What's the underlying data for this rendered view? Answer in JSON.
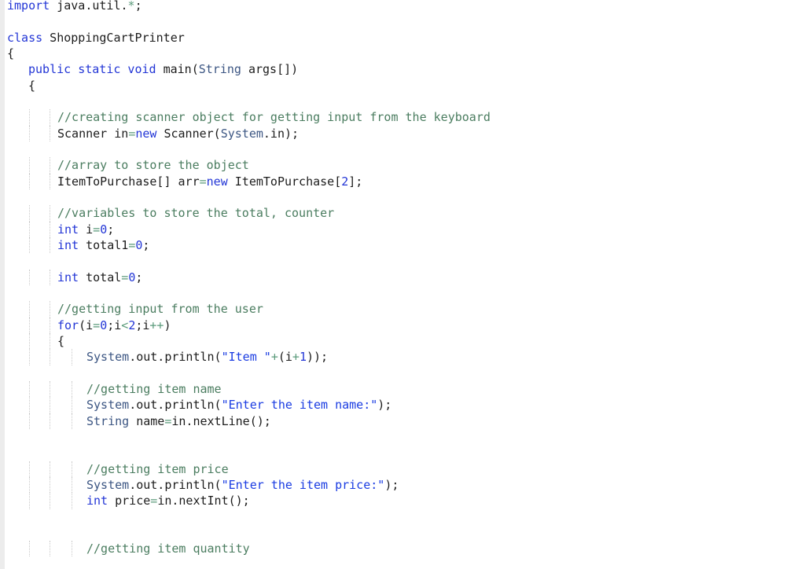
{
  "editor": {
    "language": "java",
    "colors": {
      "keyword": "#2336d6",
      "comment": "#4b7d60",
      "type": "#3c5683",
      "string": "#1a3ce2",
      "text": "#1c1c1c"
    },
    "lines": [
      {
        "level": 0,
        "tokens": [
          {
            "t": "import",
            "c": "kw"
          },
          {
            "t": " java.util.",
            "c": "tx"
          },
          {
            "t": "*",
            "c": "op"
          },
          {
            "t": ";",
            "c": "tx"
          }
        ]
      },
      {
        "level": 0,
        "tokens": []
      },
      {
        "level": 0,
        "tokens": [
          {
            "t": "class",
            "c": "kw"
          },
          {
            "t": " ShoppingCartPrinter",
            "c": "tx"
          }
        ]
      },
      {
        "level": 0,
        "tokens": [
          {
            "t": "{",
            "c": "tx"
          }
        ]
      },
      {
        "level": 1,
        "tokens": [
          {
            "t": "public static void",
            "c": "kw"
          },
          {
            "t": " main(",
            "c": "tx"
          },
          {
            "t": "String",
            "c": "ty"
          },
          {
            "t": " args[])",
            "c": "tx"
          }
        ]
      },
      {
        "level": 1,
        "tokens": [
          {
            "t": "{",
            "c": "tx"
          }
        ]
      },
      {
        "level": 0,
        "tokens": []
      },
      {
        "level": 2,
        "tokens": [
          {
            "t": "//creating scanner object for getting input from the keyboard",
            "c": "cm"
          }
        ]
      },
      {
        "level": 2,
        "tokens": [
          {
            "t": "Scanner in",
            "c": "tx"
          },
          {
            "t": "=",
            "c": "op"
          },
          {
            "t": "new",
            "c": "kw"
          },
          {
            "t": " Scanner(",
            "c": "tx"
          },
          {
            "t": "System",
            "c": "ty"
          },
          {
            "t": ".in);",
            "c": "tx"
          }
        ]
      },
      {
        "level": 0,
        "tokens": []
      },
      {
        "level": 2,
        "tokens": [
          {
            "t": "//array to store the object",
            "c": "cm"
          }
        ]
      },
      {
        "level": 2,
        "tokens": [
          {
            "t": "ItemToPurchase[] arr",
            "c": "tx"
          },
          {
            "t": "=",
            "c": "op"
          },
          {
            "t": "new",
            "c": "kw"
          },
          {
            "t": " ItemToPurchase[",
            "c": "tx"
          },
          {
            "t": "2",
            "c": "nm"
          },
          {
            "t": "];",
            "c": "tx"
          }
        ]
      },
      {
        "level": 0,
        "tokens": []
      },
      {
        "level": 2,
        "tokens": [
          {
            "t": "//variables to store the total, counter",
            "c": "cm"
          }
        ]
      },
      {
        "level": 2,
        "tokens": [
          {
            "t": "int",
            "c": "kw"
          },
          {
            "t": " i",
            "c": "tx"
          },
          {
            "t": "=",
            "c": "op"
          },
          {
            "t": "0",
            "c": "nm"
          },
          {
            "t": ";",
            "c": "tx"
          }
        ]
      },
      {
        "level": 2,
        "tokens": [
          {
            "t": "int",
            "c": "kw"
          },
          {
            "t": " total1",
            "c": "tx"
          },
          {
            "t": "=",
            "c": "op"
          },
          {
            "t": "0",
            "c": "nm"
          },
          {
            "t": ";",
            "c": "tx"
          }
        ]
      },
      {
        "level": 0,
        "tokens": []
      },
      {
        "level": 2,
        "tokens": [
          {
            "t": "int",
            "c": "kw"
          },
          {
            "t": " total",
            "c": "tx"
          },
          {
            "t": "=",
            "c": "op"
          },
          {
            "t": "0",
            "c": "nm"
          },
          {
            "t": ";",
            "c": "tx"
          }
        ]
      },
      {
        "level": 0,
        "tokens": []
      },
      {
        "level": 2,
        "tokens": [
          {
            "t": "//getting input from the user",
            "c": "cm"
          }
        ]
      },
      {
        "level": 2,
        "tokens": [
          {
            "t": "for",
            "c": "kw"
          },
          {
            "t": "(i",
            "c": "tx"
          },
          {
            "t": "=",
            "c": "op"
          },
          {
            "t": "0",
            "c": "nm"
          },
          {
            "t": ";i",
            "c": "tx"
          },
          {
            "t": "<",
            "c": "op"
          },
          {
            "t": "2",
            "c": "nm"
          },
          {
            "t": ";i",
            "c": "tx"
          },
          {
            "t": "++",
            "c": "op"
          },
          {
            "t": ")",
            "c": "tx"
          }
        ]
      },
      {
        "level": 2,
        "tokens": [
          {
            "t": "{",
            "c": "tx"
          }
        ]
      },
      {
        "level": 3,
        "tokens": [
          {
            "t": "System",
            "c": "ty"
          },
          {
            "t": ".out.println(",
            "c": "tx"
          },
          {
            "t": "\"Item \"",
            "c": "st"
          },
          {
            "t": "+",
            "c": "op"
          },
          {
            "t": "(i",
            "c": "tx"
          },
          {
            "t": "+",
            "c": "op"
          },
          {
            "t": "1",
            "c": "nm"
          },
          {
            "t": "));",
            "c": "tx"
          }
        ]
      },
      {
        "level": 0,
        "tokens": []
      },
      {
        "level": 3,
        "tokens": [
          {
            "t": "//getting item name",
            "c": "cm"
          }
        ]
      },
      {
        "level": 3,
        "tokens": [
          {
            "t": "System",
            "c": "ty"
          },
          {
            "t": ".out.println(",
            "c": "tx"
          },
          {
            "t": "\"Enter the item name:\"",
            "c": "st"
          },
          {
            "t": ");",
            "c": "tx"
          }
        ]
      },
      {
        "level": 3,
        "tokens": [
          {
            "t": "String",
            "c": "ty"
          },
          {
            "t": " name",
            "c": "tx"
          },
          {
            "t": "=",
            "c": "op"
          },
          {
            "t": "in.nextLine();",
            "c": "tx"
          }
        ]
      },
      {
        "level": 0,
        "tokens": []
      },
      {
        "level": 0,
        "tokens": []
      },
      {
        "level": 3,
        "tokens": [
          {
            "t": "//getting item price",
            "c": "cm"
          }
        ]
      },
      {
        "level": 3,
        "tokens": [
          {
            "t": "System",
            "c": "ty"
          },
          {
            "t": ".out.println(",
            "c": "tx"
          },
          {
            "t": "\"Enter the item price:\"",
            "c": "st"
          },
          {
            "t": ");",
            "c": "tx"
          }
        ]
      },
      {
        "level": 3,
        "tokens": [
          {
            "t": "int",
            "c": "kw"
          },
          {
            "t": " price",
            "c": "tx"
          },
          {
            "t": "=",
            "c": "op"
          },
          {
            "t": "in.nextInt();",
            "c": "tx"
          }
        ]
      },
      {
        "level": 0,
        "tokens": []
      },
      {
        "level": 0,
        "tokens": []
      },
      {
        "level": 3,
        "tokens": [
          {
            "t": "//getting item quantity",
            "c": "cm"
          }
        ]
      }
    ]
  }
}
